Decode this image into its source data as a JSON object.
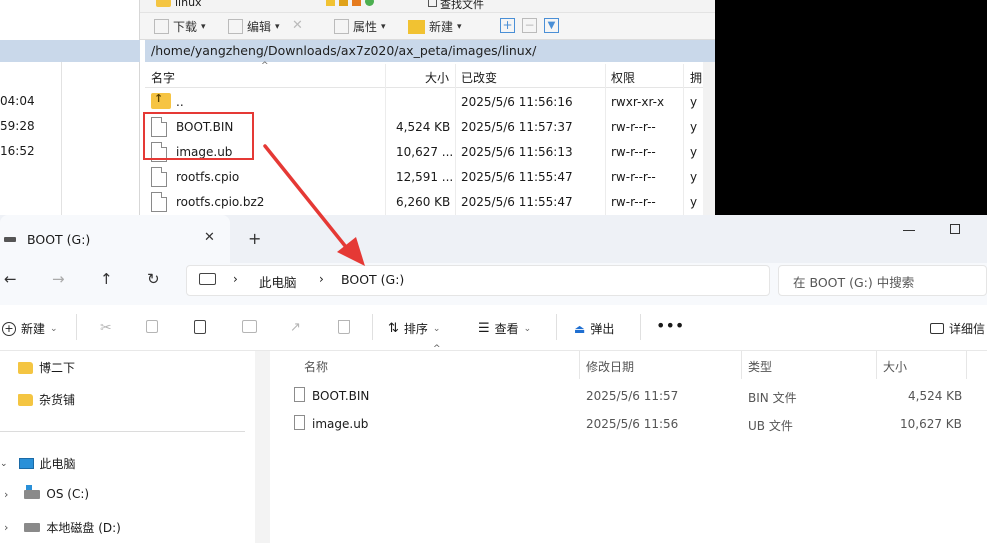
{
  "winscp": {
    "top_folder_tab": "linux",
    "top_find_label": "查找文件",
    "toolbar": {
      "download": "下载",
      "edit": "编辑",
      "properties": "属性",
      "new": "新建"
    },
    "left_pane_times": [
      "04:04",
      "59:28",
      "16:52"
    ],
    "path": "/home/yangzheng/Downloads/ax7z020/ax_peta/images/linux/",
    "columns": {
      "name": "名字",
      "size": "大小",
      "modified": "已改变",
      "rights": "权限",
      "owner": "拥"
    },
    "files": [
      {
        "name": "..",
        "size": "",
        "modified": "2025/5/6 11:56:16",
        "rights": "rwxr-xr-x",
        "owner": "y"
      },
      {
        "name": "BOOT.BIN",
        "size": "4,524 KB",
        "modified": "2025/5/6 11:57:37",
        "rights": "rw-r--r--",
        "owner": "y"
      },
      {
        "name": "image.ub",
        "size": "10,627 ...",
        "modified": "2025/5/6 11:56:13",
        "rights": "rw-r--r--",
        "owner": "y"
      },
      {
        "name": "rootfs.cpio",
        "size": "12,591 ...",
        "modified": "2025/5/6 11:55:47",
        "rights": "rw-r--r--",
        "owner": "y"
      },
      {
        "name": "rootfs.cpio.bz2",
        "size": "6,260 KB",
        "modified": "2025/5/6 11:55:47",
        "rights": "rw-r--r--",
        "owner": "y"
      }
    ]
  },
  "explorer": {
    "tab_title": "BOOT (G:)",
    "breadcrumb": [
      "此电脑",
      "BOOT (G:)"
    ],
    "search_placeholder": "在 BOOT (G:) 中搜索",
    "commands": {
      "new": "新建",
      "sort": "排序",
      "view": "查看",
      "eject": "弹出",
      "details": "详细信"
    },
    "nav_items": [
      {
        "label": "博二下",
        "type": "folder"
      },
      {
        "label": "杂货铺",
        "type": "folder"
      },
      {
        "label": "此电脑",
        "type": "pc"
      },
      {
        "label": "OS (C:)",
        "type": "drive"
      },
      {
        "label": "本地磁盘 (D:)",
        "type": "drive"
      }
    ],
    "columns": {
      "name": "名称",
      "modified": "修改日期",
      "type": "类型",
      "size": "大小"
    },
    "files": [
      {
        "name": "BOOT.BIN",
        "modified": "2025/5/6 11:57",
        "type": "BIN 文件",
        "size": "4,524 KB"
      },
      {
        "name": "image.ub",
        "modified": "2025/5/6 11:56",
        "type": "UB 文件",
        "size": "10,627 KB"
      }
    ]
  },
  "annotation": {
    "color": "#e53935"
  }
}
